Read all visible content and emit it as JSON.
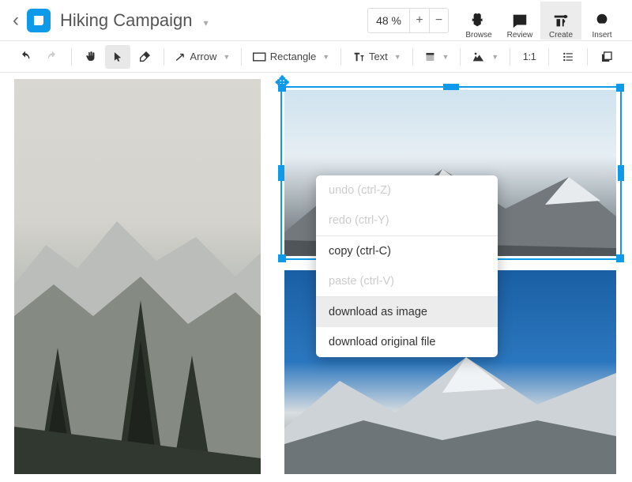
{
  "header": {
    "title": "Hiking Campaign",
    "zoom": "48 %",
    "modes": [
      {
        "key": "browse",
        "label": "Browse"
      },
      {
        "key": "review",
        "label": "Review"
      },
      {
        "key": "create",
        "label": "Create"
      },
      {
        "key": "insert",
        "label": "Insert"
      }
    ],
    "active_mode": "create"
  },
  "toolbar": {
    "undo": "undo",
    "redo": "redo",
    "pan": "pan",
    "select": "select",
    "erase": "erase",
    "arrow": "Arrow",
    "rectangle": "Rectangle",
    "text": "Text",
    "fill": "fill",
    "crop": "crop",
    "ratio": "1:1",
    "list": "list",
    "stack": "stack"
  },
  "context_menu": {
    "items": [
      {
        "label": "undo (ctrl-Z)",
        "enabled": false
      },
      {
        "label": "redo (ctrl-Y)",
        "enabled": false
      },
      {
        "label": "copy (ctrl-C)",
        "enabled": true
      },
      {
        "label": "paste (ctrl-V)",
        "enabled": false
      },
      {
        "label": "download as image",
        "enabled": true,
        "hover": true
      },
      {
        "label": "download original file",
        "enabled": true
      }
    ]
  },
  "colors": {
    "accent": "#0E9AE8"
  }
}
